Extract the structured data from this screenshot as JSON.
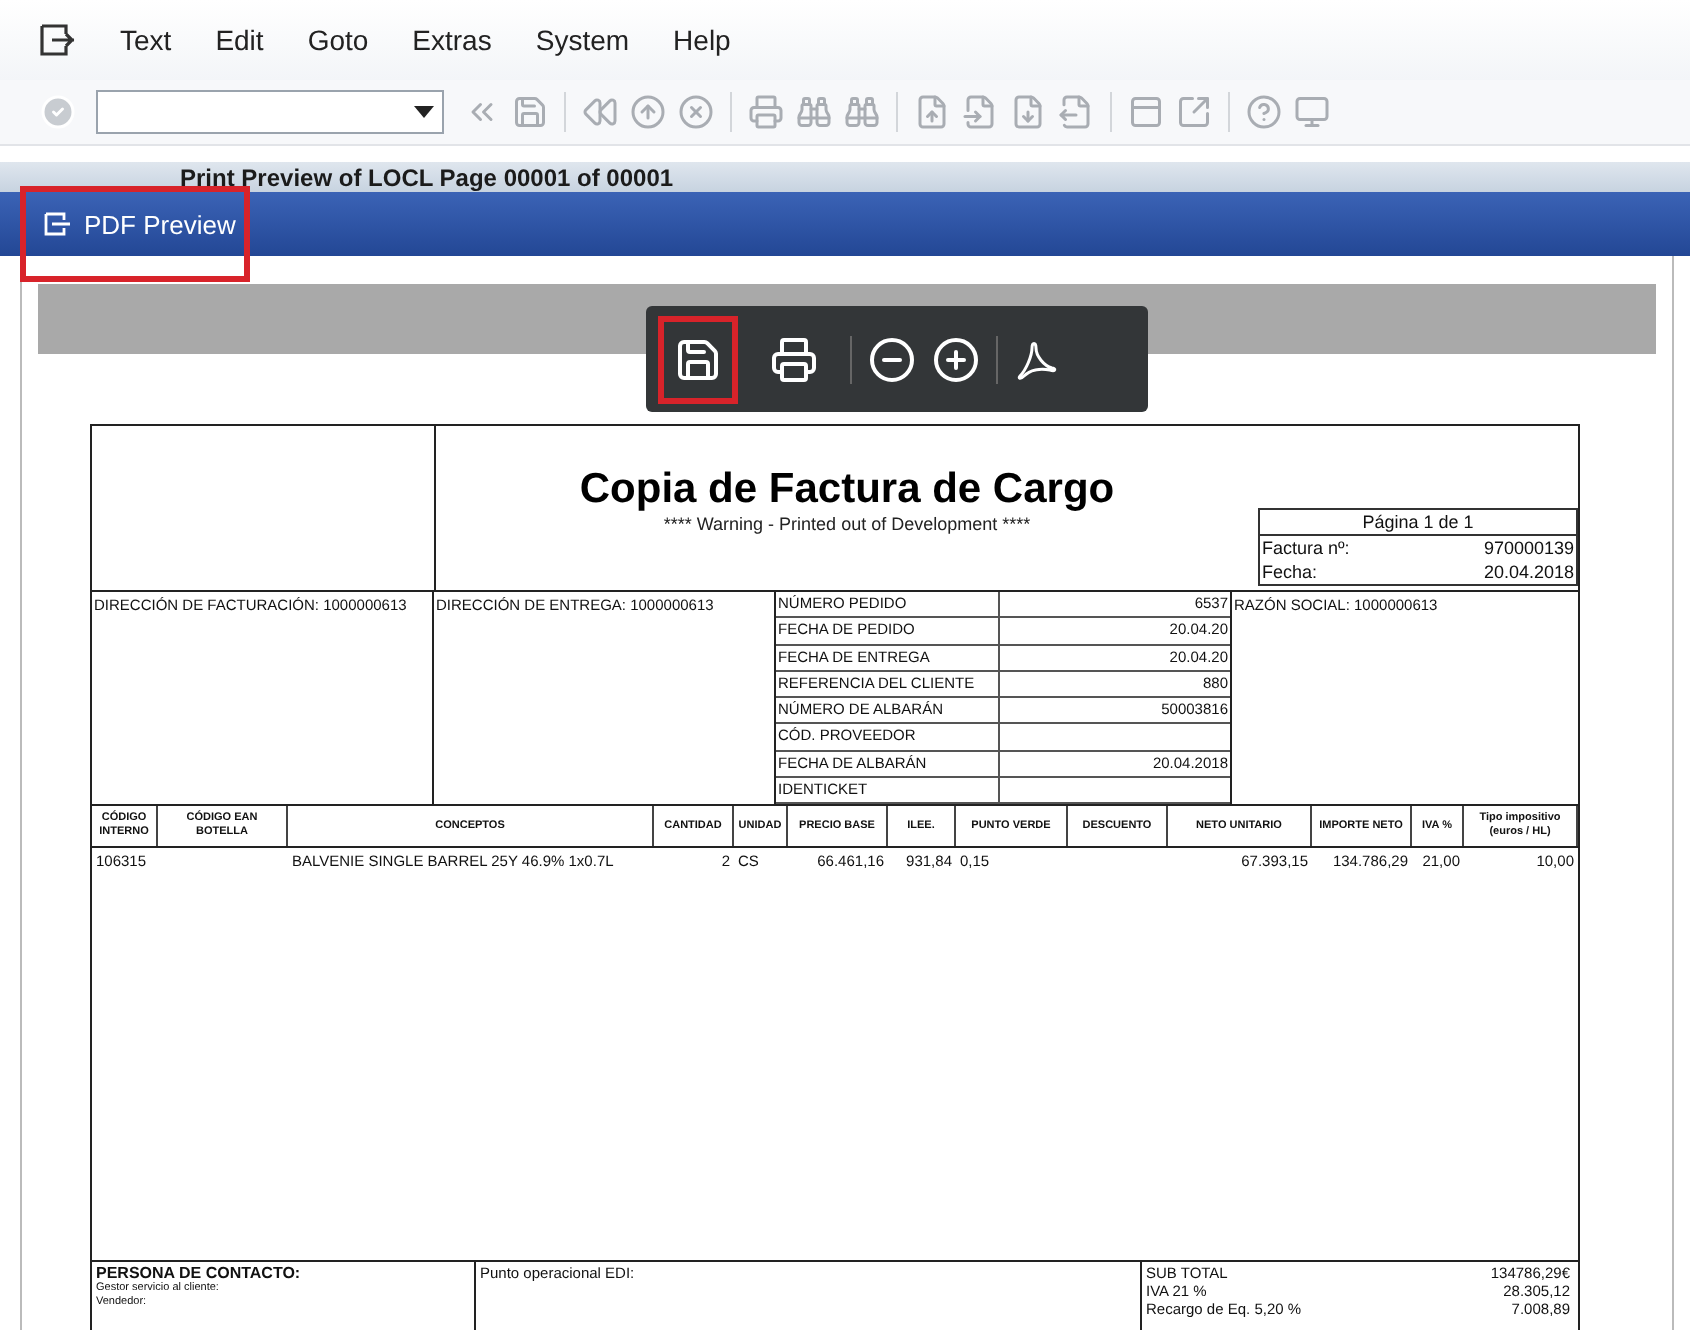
{
  "menu": [
    "Text",
    "Edit",
    "Goto",
    "Extras",
    "System",
    "Help"
  ],
  "background_title": "Print Preview of LOCL Page 00001 of 00001",
  "dialog": {
    "title": "PDF Preview",
    "highlighted": true
  },
  "pdf_toolbar": {
    "save_highlighted": true
  },
  "document": {
    "title": "Copia de Factura de Cargo",
    "subtitle": "**** Warning - Printed out of Development ****",
    "page_box": {
      "page": "Página 1 de 1",
      "rows": [
        {
          "label": "Factura nº:",
          "value": "970000139"
        },
        {
          "label": "Fecha:",
          "value": "20.04.2018"
        }
      ]
    },
    "billing_address": "DIRECCIÓN DE FACTURACIÓN:  1000000613",
    "delivery_address": "DIRECCIÓN DE ENTREGA:  1000000613",
    "order_fields": [
      {
        "label": "NÚMERO PEDIDO",
        "value": "6537"
      },
      {
        "label": "FECHA DE PEDIDO",
        "value": "20.04.20"
      },
      {
        "label": "FECHA DE ENTREGA",
        "value": "20.04.20"
      },
      {
        "label": "REFERENCIA DEL CLIENTE",
        "value": "880"
      },
      {
        "label": "NÚMERO DE ALBARÁN",
        "value": "50003816"
      },
      {
        "label": "CÓD. PROVEEDOR"
      },
      {
        "label": "FECHA DE ALBARÁN",
        "value": "20.04.2018"
      },
      {
        "label": "IDENTICKET"
      }
    ],
    "company": "RAZÓN SOCIAL: 1000000613",
    "items": {
      "columns": [
        "CÓDIGO INTERNO",
        "CÓDIGO EAN BOTELLA",
        "CONCEPTOS",
        "CANTIDAD",
        "UNIDAD",
        "PRECIO BASE",
        "ILEE.",
        "PUNTO VERDE",
        "DESCUENTO",
        "NETO UNITARIO",
        "IMPORTE NETO",
        "IVA %",
        "Tipo impositivo (euros / HL)"
      ],
      "rows": [
        [
          "106315",
          null,
          "BALVENIE SINGLE BARREL 25Y 46.9% 1x0.7L",
          "2",
          "CS",
          "66.461,16",
          "931,84",
          "0,15",
          null,
          "67.393,15",
          "134.786,29",
          "21,00",
          "10,00"
        ]
      ]
    },
    "contact": {
      "title": "PERSONA DE CONTACTO:",
      "lines": [
        "Gestor servicio al cliente:",
        "Vendedor:"
      ]
    },
    "edi": "Punto operacional EDI:",
    "totals": [
      {
        "label": "SUB TOTAL",
        "value": "134786,29€"
      },
      {
        "label": "IVA 21 %",
        "value": "28.305,12"
      },
      {
        "label": "Recargo de Eq. 5,20 %",
        "value": "7.008,89"
      }
    ]
  }
}
